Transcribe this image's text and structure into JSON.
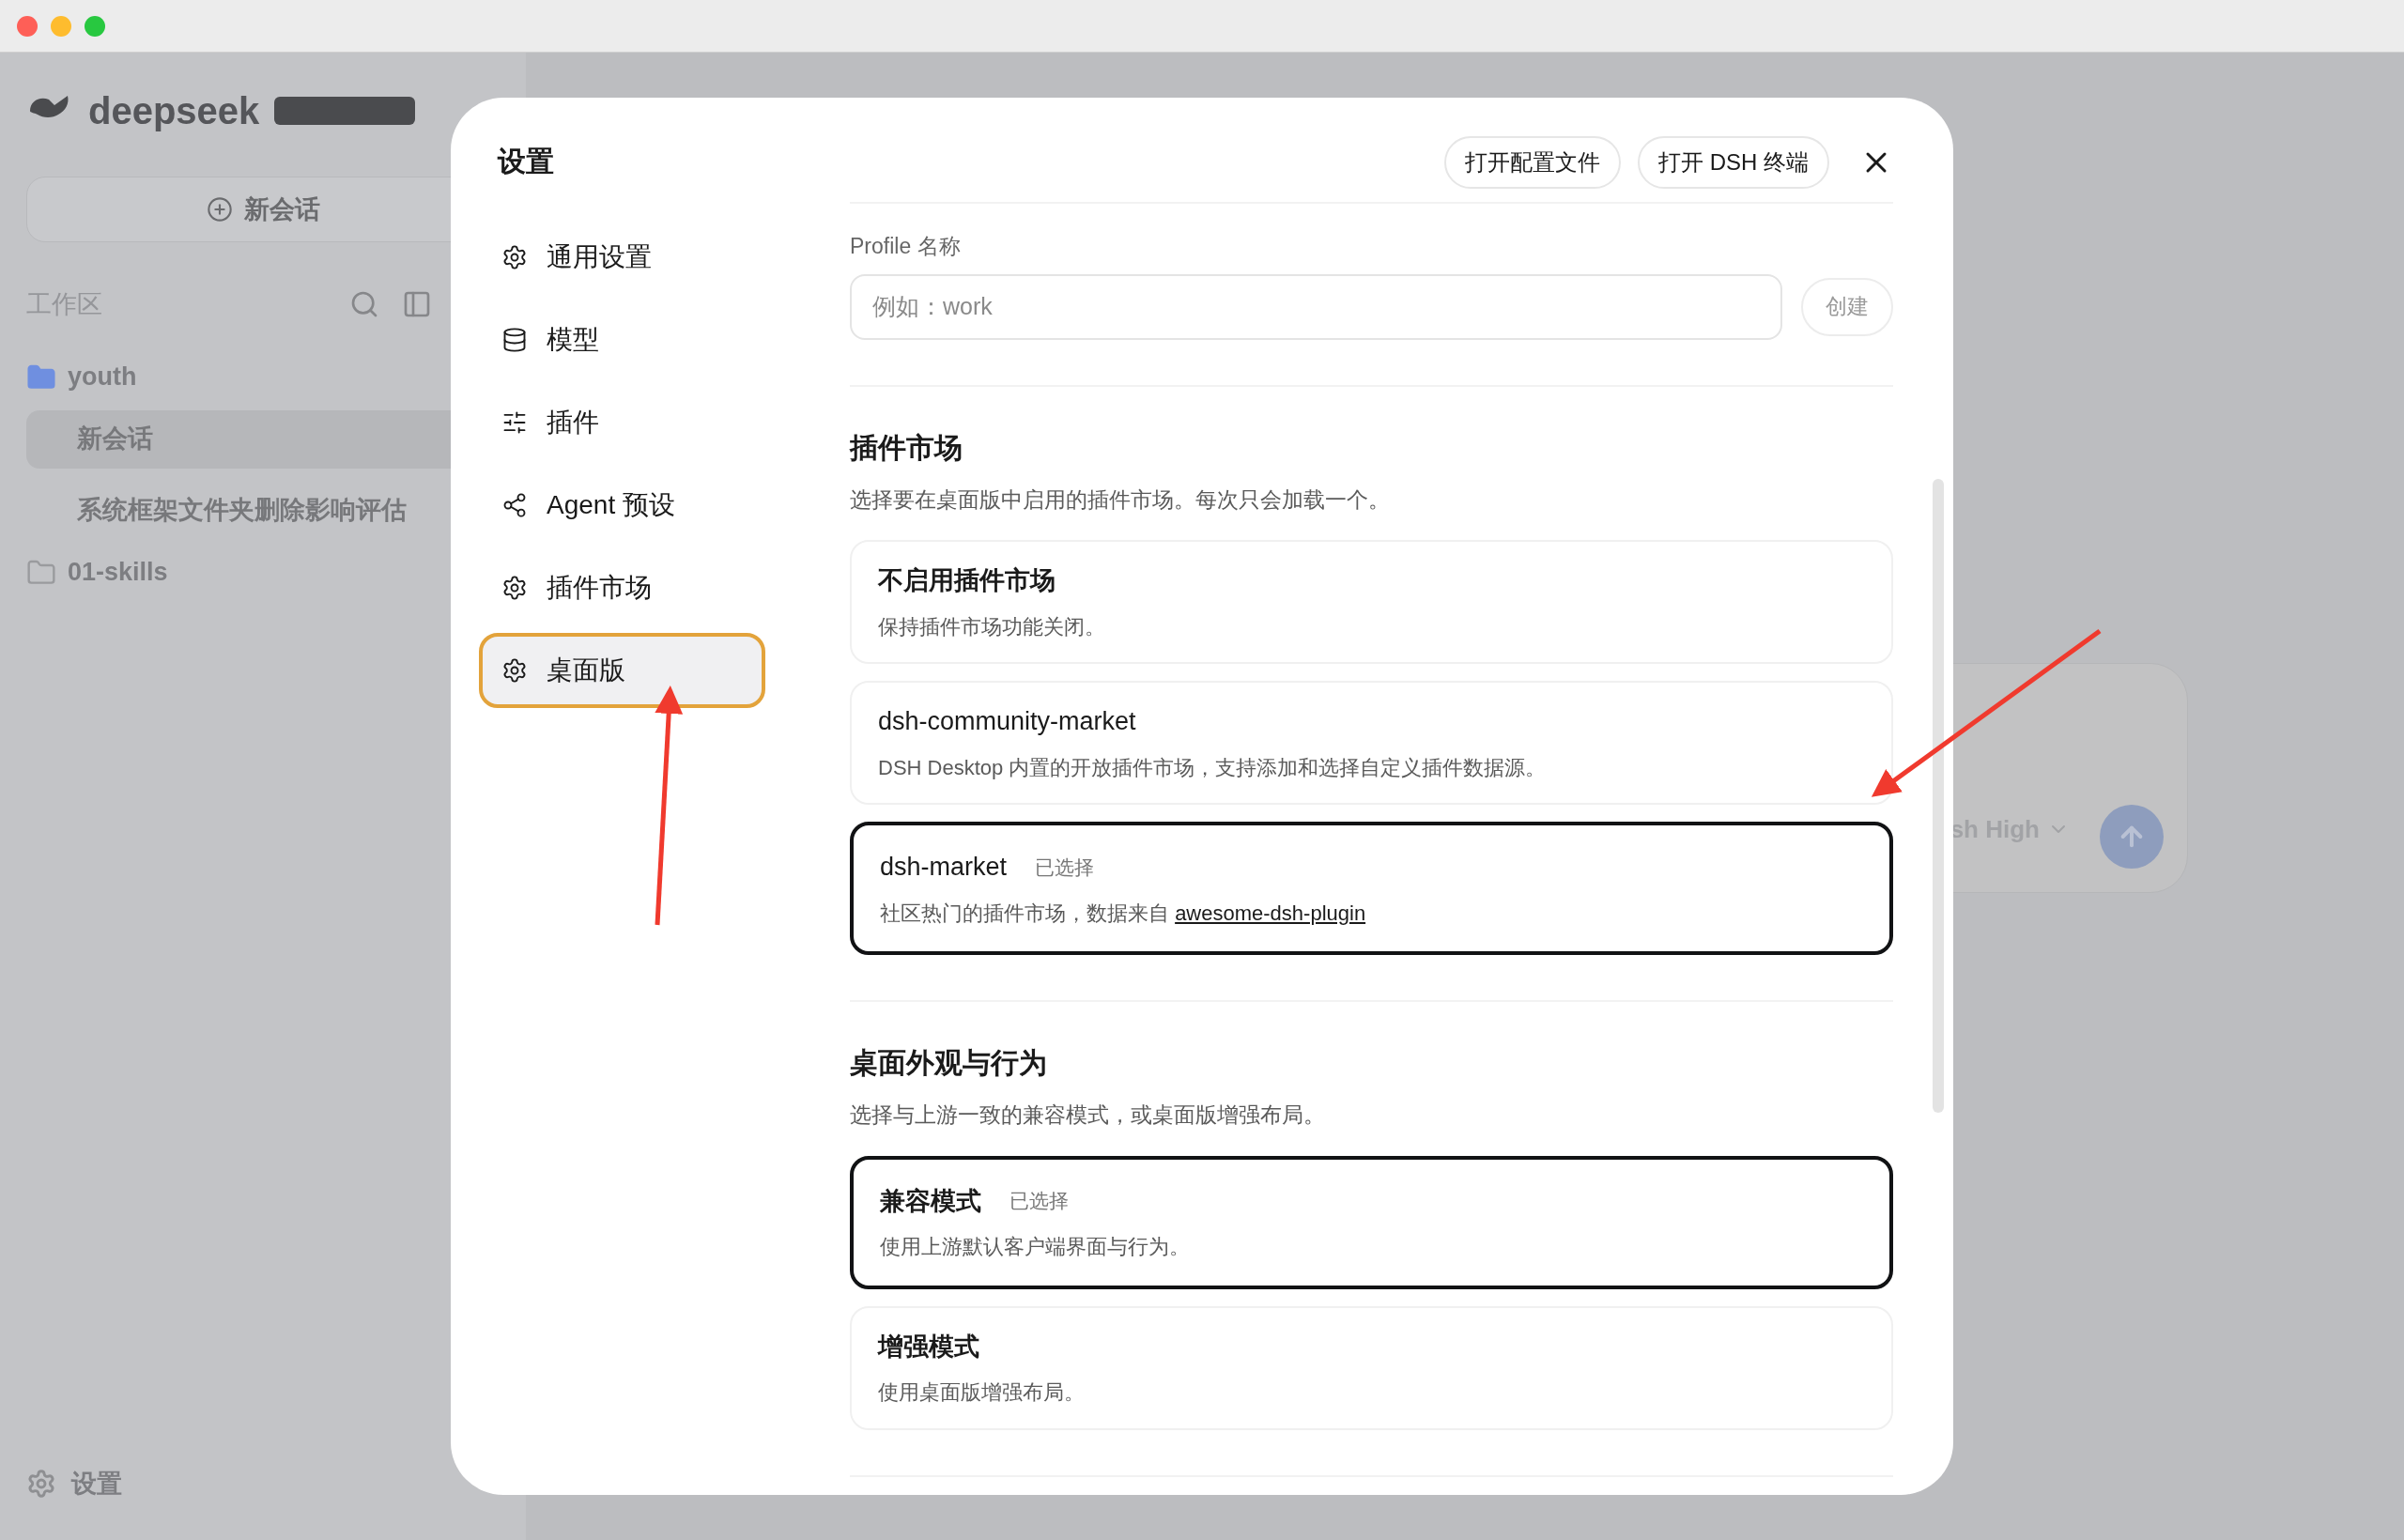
{
  "background_app": {
    "logo": "deepseek",
    "new_chat_button": "新会话",
    "workspace_label": "工作区",
    "tree": [
      {
        "label": "youth",
        "kind": "folder",
        "color": "#6f8fe0",
        "children": [
          {
            "label": "新会话",
            "selected": true
          },
          {
            "label": "系统框架文件夹删除影响评估",
            "selected": false
          }
        ]
      },
      {
        "label": "01-skills",
        "kind": "folder",
        "color": "#9a9b9e"
      }
    ],
    "settings_link": "设置",
    "composer_model": "sh High"
  },
  "dialog": {
    "title": "设置",
    "header_buttons": [
      "打开配置文件",
      "打开 DSH 终端"
    ],
    "nav": [
      {
        "label": "通用设置",
        "selected": false
      },
      {
        "label": "模型",
        "selected": false
      },
      {
        "label": "插件",
        "selected": false
      },
      {
        "label": "Agent 预设",
        "selected": false
      },
      {
        "label": "插件市场",
        "selected": false
      },
      {
        "label": "桌面版",
        "selected": true
      }
    ],
    "profile": {
      "label": "Profile 名称",
      "placeholder": "例如：work",
      "create_button": "创建"
    },
    "sections": [
      {
        "title": "插件市场",
        "description": "选择要在桌面版中启用的插件市场。每次只会加载一个。",
        "options": [
          {
            "title": "不启用插件市场",
            "description": "保持插件市场功能关闭。",
            "selected": false
          },
          {
            "title": "dsh-community-market",
            "description": "DSH Desktop 内置的开放插件市场，支持添加和选择自定义插件数据源。",
            "selected": false
          },
          {
            "title": "dsh-market",
            "badge": "已选择",
            "description": "社区热门的插件市场，数据来自 ",
            "link": "awesome-dsh-plugin",
            "selected": true
          }
        ]
      },
      {
        "title": "桌面外观与行为",
        "description": "选择与上游一致的兼容模式，或桌面版增强布局。",
        "options": [
          {
            "title": "兼容模式",
            "badge": "已选择",
            "description": "使用上游默认客户端界面与行为。",
            "selected": true
          },
          {
            "title": "增强模式",
            "description": "使用桌面版增强布局。",
            "selected": false
          }
        ]
      }
    ]
  }
}
